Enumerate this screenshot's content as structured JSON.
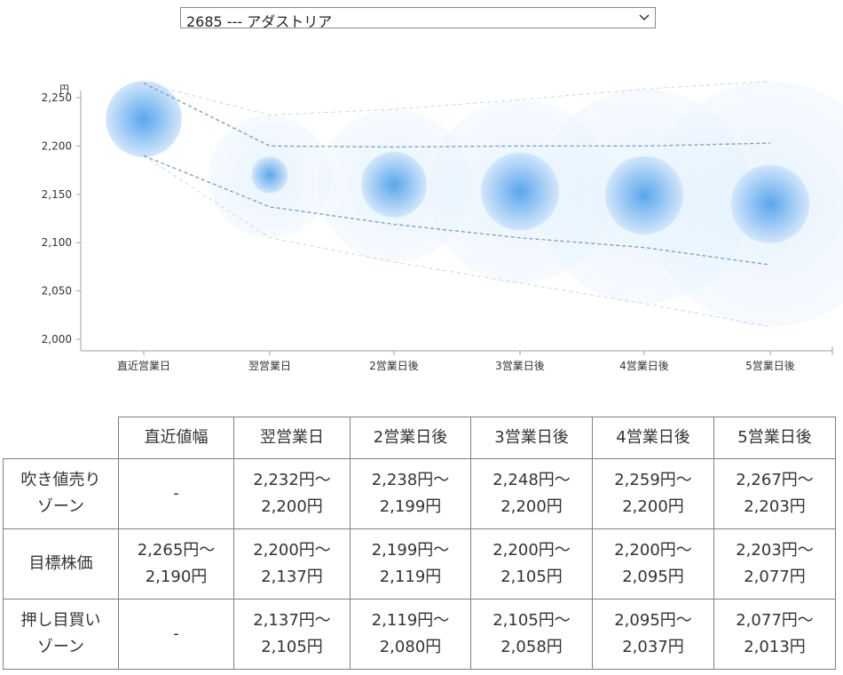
{
  "selector": {
    "value": "2685 --- アダストリア"
  },
  "chart_data": {
    "type": "scatter",
    "y_unit": "円",
    "categories": [
      "直近営業日",
      "翌営業日",
      "2営業日後",
      "3営業日後",
      "4営業日後",
      "5営業日後"
    ],
    "ylim": [
      2000,
      2250
    ],
    "yticks": [
      2000,
      2050,
      2100,
      2150,
      2200,
      2250
    ],
    "ytick_labels": [
      "2,000",
      "2,050",
      "2,100",
      "2,150",
      "2,200",
      "2,250"
    ],
    "grid": false,
    "target": [
      2228,
      2170,
      2160,
      2153,
      2149,
      2140
    ],
    "target_range_low": [
      2190,
      2137,
      2119,
      2105,
      2095,
      2077
    ],
    "target_range_high": [
      2265,
      2200,
      2199,
      2200,
      2200,
      2203
    ],
    "outer_range_low": [
      2190,
      2105,
      2080,
      2058,
      2037,
      2013
    ],
    "outer_range_high": [
      2265,
      2232,
      2238,
      2248,
      2259,
      2267
    ],
    "colors": {
      "bubble_core": "#5aa6ec",
      "bubble_halo": "#d8ebfc",
      "dash_line": "#6f9fc6",
      "outer_line": "#c7d6e3"
    }
  },
  "table": {
    "headers": [
      "",
      "直近値幅",
      "翌営業日",
      "2営業日後",
      "3営業日後",
      "4営業日後",
      "5営業日後"
    ],
    "rows": [
      {
        "label": [
          "吹き値売り",
          "ゾーン"
        ],
        "cells": [
          [
            "-"
          ],
          [
            "2,232円～",
            "2,200円"
          ],
          [
            "2,238円～",
            "2,199円"
          ],
          [
            "2,248円～",
            "2,200円"
          ],
          [
            "2,259円～",
            "2,200円"
          ],
          [
            "2,267円～",
            "2,203円"
          ]
        ]
      },
      {
        "label": [
          "目標株価"
        ],
        "cells": [
          [
            "2,265円～",
            "2,190円"
          ],
          [
            "2,200円～",
            "2,137円"
          ],
          [
            "2,199円～",
            "2,119円"
          ],
          [
            "2,200円～",
            "2,105円"
          ],
          [
            "2,200円～",
            "2,095円"
          ],
          [
            "2,203円～",
            "2,077円"
          ]
        ]
      },
      {
        "label": [
          "押し目買い",
          "ゾーン"
        ],
        "cells": [
          [
            "-"
          ],
          [
            "2,137円～",
            "2,105円"
          ],
          [
            "2,119円～",
            "2,080円"
          ],
          [
            "2,105円～",
            "2,058円"
          ],
          [
            "2,095円～",
            "2,037円"
          ],
          [
            "2,077円～",
            "2,013円"
          ]
        ]
      }
    ]
  }
}
